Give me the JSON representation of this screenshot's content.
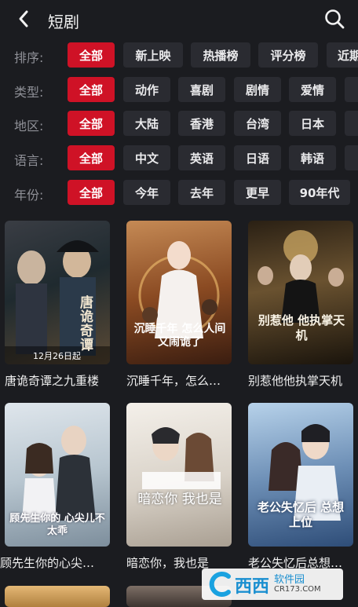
{
  "header": {
    "title": "短剧"
  },
  "filters": [
    {
      "label": "排序:",
      "options": [
        "全部",
        "新上映",
        "热播榜",
        "评分榜",
        "近期"
      ]
    },
    {
      "label": "类型:",
      "options": [
        "全部",
        "动作",
        "喜剧",
        "剧情",
        "爱情"
      ]
    },
    {
      "label": "地区:",
      "options": [
        "全部",
        "大陆",
        "香港",
        "台湾",
        "日本"
      ]
    },
    {
      "label": "语言:",
      "options": [
        "全部",
        "中文",
        "英语",
        "日语",
        "韩语"
      ]
    },
    {
      "label": "年份:",
      "options": [
        "全部",
        "今年",
        "去年",
        "更早",
        "90年代"
      ]
    }
  ],
  "cards": [
    {
      "title": "唐诡奇谭之九重楼",
      "poster_text": "唐诡奇谭",
      "date_text": "12月26日起"
    },
    {
      "title": "沉睡千年，怎么…",
      "poster_text": "沉睡千年 怎么人间又闹诡了"
    },
    {
      "title": "别惹他他执掌天机",
      "poster_text": "别惹他 他执掌天机"
    },
    {
      "title": "顾先生你的心尖…",
      "poster_text": "顾先生你的 心尖儿不太乖"
    },
    {
      "title": "暗恋你，我也是",
      "poster_text": "暗恋你 我也是"
    },
    {
      "title": "老公失忆后总想…",
      "poster_text": "老公失忆后 总想上位"
    }
  ],
  "watermark": {
    "brand": "西西",
    "sub": "软件园",
    "url": "CR173.COM"
  },
  "colors": {
    "accent": "#cf1226",
    "chip": "#2a2b31",
    "bg": "#1b1c20"
  }
}
